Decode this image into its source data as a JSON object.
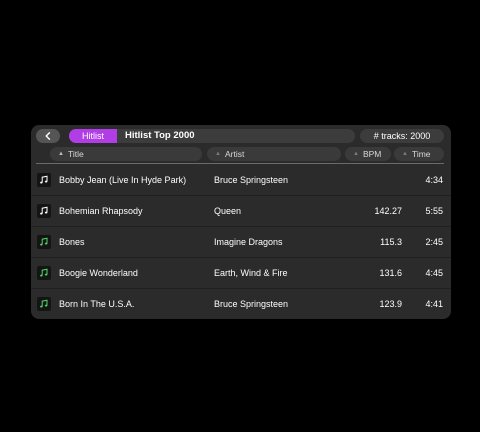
{
  "header": {
    "breadcrumb_label": "Hitlist",
    "playlist_title": "Hitlist Top 2000",
    "track_count": "# tracks: 2000"
  },
  "columns": {
    "title": "Title",
    "artist": "Artist",
    "bpm": "BPM",
    "time": "Time"
  },
  "colors": {
    "accent": "#b03de6",
    "note_white": "#ffffff",
    "note_green": "#4cd964",
    "panel": "#2b2b2b"
  },
  "tracks": [
    {
      "title": "Bobby Jean (Live In Hyde Park)",
      "artist": "Bruce Springsteen",
      "bpm": "",
      "time": "4:34",
      "icon": "music-note-icon-white"
    },
    {
      "title": "Bohemian Rhapsody",
      "artist": "Queen",
      "bpm": "142.27",
      "time": "5:55",
      "icon": "music-note-icon-white"
    },
    {
      "title": "Bones",
      "artist": "Imagine Dragons",
      "bpm": "115.3",
      "time": "2:45",
      "icon": "music-note-icon-green"
    },
    {
      "title": "Boogie Wonderland",
      "artist": "Earth, Wind & Fire",
      "bpm": "131.6",
      "time": "4:45",
      "icon": "music-note-icon-green"
    },
    {
      "title": "Born In The U.S.A.",
      "artist": "Bruce Springsteen",
      "bpm": "123.9",
      "time": "4:41",
      "icon": "music-note-icon-green"
    }
  ]
}
